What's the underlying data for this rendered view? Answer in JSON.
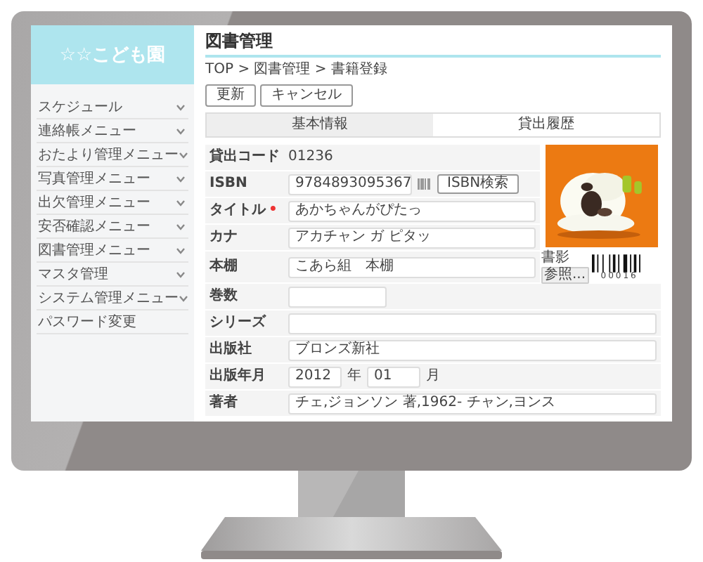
{
  "sidebar": {
    "title": "☆☆こども園",
    "items": [
      {
        "label": "スケジュール",
        "kind": "menu"
      },
      {
        "label": "連絡帳メニュー",
        "kind": "menu"
      },
      {
        "label": "おたより管理メニュー",
        "kind": "menu"
      },
      {
        "label": "写真管理メニュー",
        "kind": "menu"
      },
      {
        "label": "出欠管理メニュー",
        "kind": "menu"
      },
      {
        "label": "安否確認メニュー",
        "kind": "menu"
      },
      {
        "label": "図書管理メニュー",
        "kind": "menu"
      },
      {
        "label": "マスタ管理",
        "kind": "menu"
      },
      {
        "label": "システム管理メニュー",
        "kind": "menu"
      },
      {
        "label": "パスワード変更",
        "kind": "link"
      }
    ]
  },
  "main": {
    "title": "図書管理",
    "breadcrumb": "TOP > 図書管理 > 書籍登録",
    "buttons": [
      "更新",
      "キャンセル"
    ],
    "tabs": [
      {
        "label": "基本情報",
        "selected": true
      },
      {
        "label": "貸出履歴",
        "selected": false
      }
    ],
    "cover": {
      "kind": "picture",
      "label": "書影",
      "button": "参照...",
      "barcode_number": "00016"
    },
    "fields": [
      {
        "label": "貸出コード",
        "kind": "text",
        "value": "01236"
      },
      {
        "label": "ISBN",
        "kind": "isbn",
        "value": "9784893095367",
        "button": "ISBN検索"
      },
      {
        "label": "タイトル",
        "kind": "input",
        "value": "あかちゃんがぴたっ",
        "required_mark": "•"
      },
      {
        "label": "カナ",
        "kind": "input",
        "value": "アカチャン ガ ピタッ"
      },
      {
        "label": "本棚",
        "kind": "input",
        "value": "こあら組　本棚"
      },
      {
        "label": "巻数",
        "kind": "short"
      },
      {
        "label": "シリーズ",
        "kind": "input"
      },
      {
        "label": "出版社",
        "kind": "input",
        "value": "ブロンズ新社"
      },
      {
        "label": "出版年月",
        "kind": "yearmonth",
        "year": "2012",
        "year_unit": "年",
        "month": "01",
        "month_unit": "月"
      },
      {
        "label": "著者",
        "kind": "input",
        "value": "チェ,ジョンソン 著,1962- チャン,ヨンス"
      }
    ]
  }
}
